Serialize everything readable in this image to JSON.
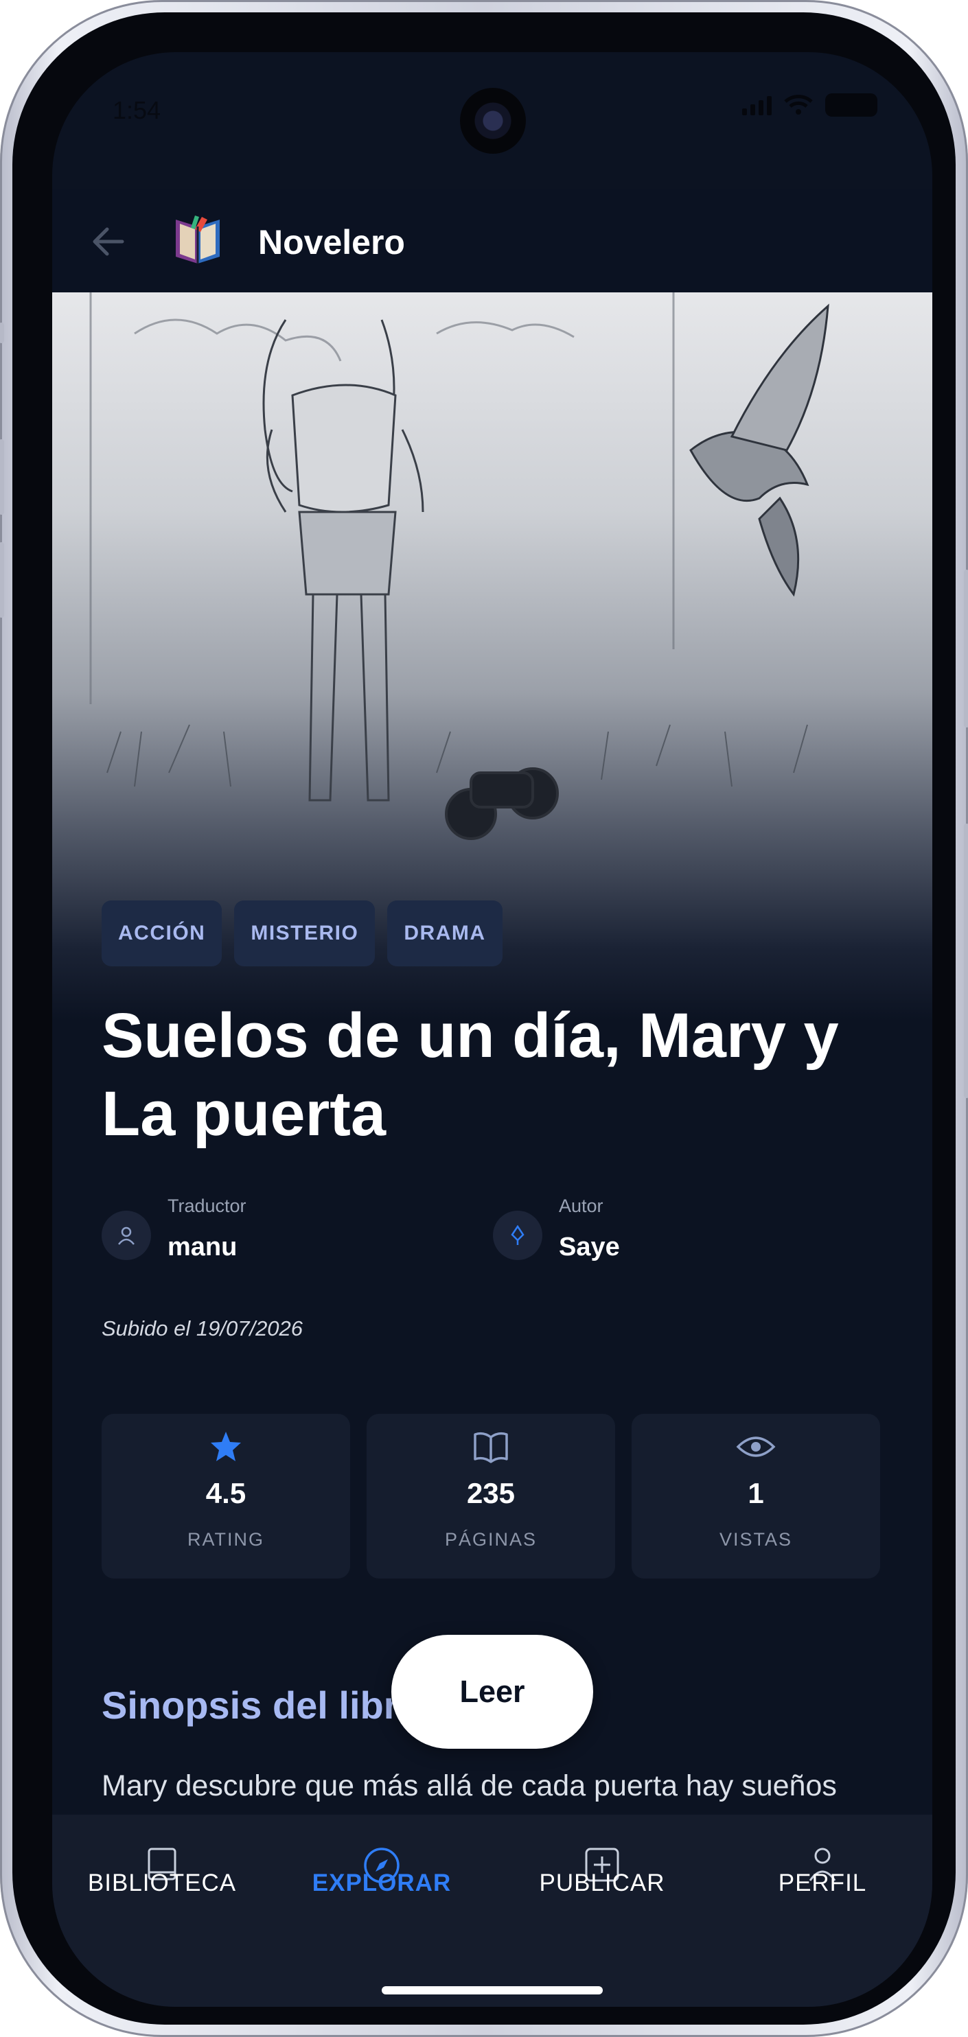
{
  "status_bar": {
    "time": "1:54"
  },
  "app_bar": {
    "title": "Novelero",
    "back_icon": "arrow-left-icon",
    "logo_icon": "book-logo-icon"
  },
  "book": {
    "tags": [
      "ACCIÓN",
      "MISTERIO",
      "DRAMA"
    ],
    "title": "Suelos de un día, Mary y La puerta",
    "translator": {
      "role": "Traductor",
      "name": "manu",
      "icon": "user-icon"
    },
    "author": {
      "role": "Autor",
      "name": "Saye",
      "icon": "pen-nib-icon"
    },
    "uploaded": "Subido el 19/07/2026",
    "stats": [
      {
        "icon": "star-icon",
        "value": "4.5",
        "label": "RATING"
      },
      {
        "icon": "book-open-icon",
        "value": "235",
        "label": "PÁGINAS"
      },
      {
        "icon": "eye-icon",
        "value": "1",
        "label": "VISTAS"
      }
    ],
    "synopsis_title": "Sinopsis del libro",
    "synopsis": "Mary descubre que más allá de cada puerta hay sueños"
  },
  "read_button": {
    "label": "Leer"
  },
  "bottom_nav": {
    "items": [
      {
        "label": "BIBLIOTECA",
        "icon": "library-icon",
        "active": false
      },
      {
        "label": "EXPLORAR",
        "icon": "compass-icon",
        "active": true
      },
      {
        "label": "PUBLICAR",
        "icon": "add-square-icon",
        "active": false
      },
      {
        "label": "PERFIL",
        "icon": "user-icon",
        "active": false
      }
    ]
  },
  "colors": {
    "background": "#0c1322",
    "accent": "#2f7df6",
    "tag_bg": "#1d2a45",
    "tag_text": "#a9b9ef",
    "section_title": "#a7b9f2",
    "nav_bg": "#151c2c"
  }
}
